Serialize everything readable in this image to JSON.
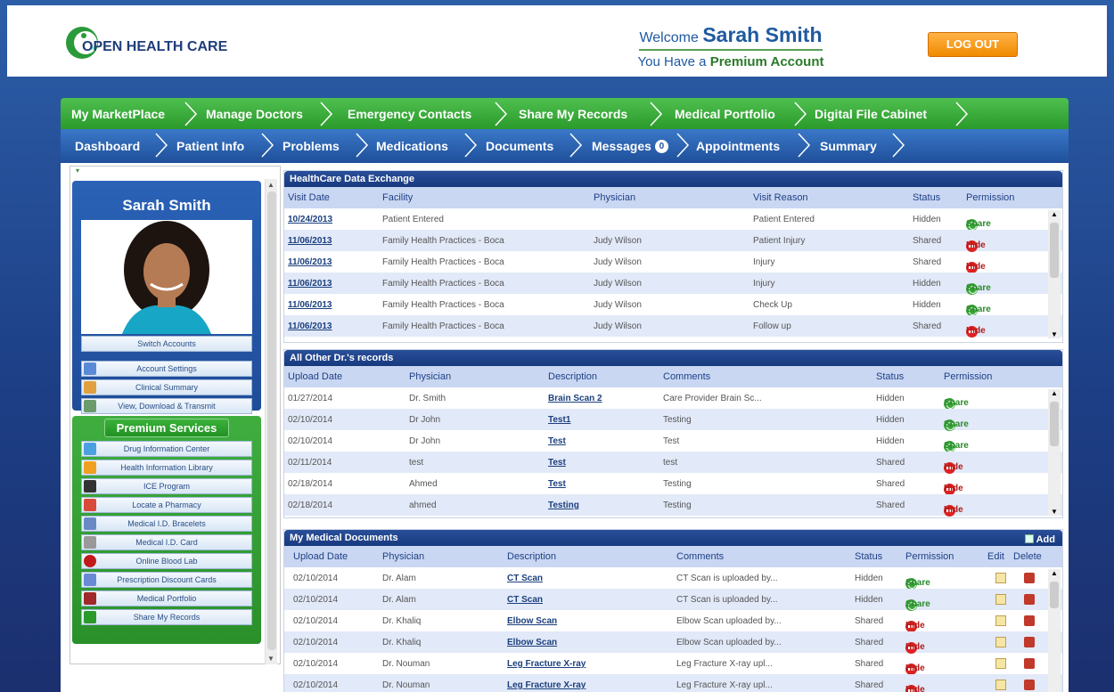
{
  "header": {
    "logo_text": "OPEN HEALTH CARE",
    "welcome_prefix": "Welcome",
    "user_name": "Sarah Smith",
    "account_prefix": "You Have a",
    "account_type": "Premium Account",
    "logout_label": "LOG OUT"
  },
  "nav_top": [
    "My MarketPlace",
    "Manage Doctors",
    "Emergency Contacts",
    "Share My Records",
    "Medical Portfolio",
    "Digital File Cabinet"
  ],
  "nav_bottom": [
    "Dashboard",
    "Patient Info",
    "Problems",
    "Medications",
    "Documents",
    "Messages",
    "Appointments",
    "Summary"
  ],
  "messages_badge": "0",
  "sidebar": {
    "name": "Sarah Smith",
    "switch_accounts": "Switch Accounts",
    "account_links": [
      "Account Settings",
      "Clinical Summary",
      "View, Download & Transmit"
    ],
    "premium_title": "Premium Services",
    "premium_links": [
      "Drug Information Center",
      "Health Information Library",
      "ICE Program",
      "Locate a Pharmacy",
      "Medical I.D. Bracelets",
      "Medical I.D. Card",
      "Online Blood Lab",
      "Prescription Discount Cards",
      "Medical Portfolio",
      "Share My Records"
    ]
  },
  "hde": {
    "title": "HealthCare Data Exchange",
    "headers": [
      "Visit Date",
      "Facility",
      "Physician",
      "Visit Reason",
      "Status",
      "Permission"
    ],
    "rows": [
      {
        "date": "10/24/2013",
        "facility": "Patient Entered",
        "physician": "",
        "reason": "Patient Entered",
        "status": "Hidden",
        "perm": "Share"
      },
      {
        "date": "11/06/2013",
        "facility": "Family Health Practices - Boca",
        "physician": "Judy Wilson",
        "reason": "Patient Injury",
        "status": "Shared",
        "perm": "Hide"
      },
      {
        "date": "11/06/2013",
        "facility": "Family Health Practices - Boca",
        "physician": "Judy Wilson",
        "reason": "Injury",
        "status": "Shared",
        "perm": "Hide"
      },
      {
        "date": "11/06/2013",
        "facility": "Family Health Practices - Boca",
        "physician": "Judy Wilson",
        "reason": "Injury",
        "status": "Hidden",
        "perm": "Share"
      },
      {
        "date": "11/06/2013",
        "facility": "Family Health Practices - Boca",
        "physician": "Judy Wilson",
        "reason": "Check Up",
        "status": "Hidden",
        "perm": "Share"
      },
      {
        "date": "11/06/2013",
        "facility": "Family Health Practices - Boca",
        "physician": "Judy Wilson",
        "reason": "Follow up",
        "status": "Shared",
        "perm": "Hide"
      }
    ]
  },
  "other": {
    "title": "All Other Dr.'s records",
    "headers": [
      "Upload Date",
      "Physician",
      "Description",
      "Comments",
      "Status",
      "Permission"
    ],
    "rows": [
      {
        "date": "01/27/2014",
        "physician": "Dr. Smith",
        "desc": "Brain Scan 2",
        "comment": "Care Provider Brain Sc...",
        "status": "Hidden",
        "perm": "Share"
      },
      {
        "date": "02/10/2014",
        "physician": "Dr John",
        "desc": "Test1",
        "comment": "Testing",
        "status": "Hidden",
        "perm": "Share"
      },
      {
        "date": "02/10/2014",
        "physician": "Dr John",
        "desc": "Test",
        "comment": "Test",
        "status": "Hidden",
        "perm": "Share"
      },
      {
        "date": "02/11/2014",
        "physician": "test",
        "desc": "Test",
        "comment": "test",
        "status": "Shared",
        "perm": "Hide"
      },
      {
        "date": "02/18/2014",
        "physician": "Ahmed",
        "desc": "Test",
        "comment": "Testing",
        "status": "Shared",
        "perm": "Hide"
      },
      {
        "date": "02/18/2014",
        "physician": "ahmed",
        "desc": "Testing",
        "comment": "Testing",
        "status": "Shared",
        "perm": "Hide"
      }
    ]
  },
  "docs": {
    "title": "My Medical Documents",
    "add_label": "Add",
    "headers": [
      "Upload Date",
      "Physician",
      "Description",
      "Comments",
      "Status",
      "Permission",
      "Edit",
      "Delete"
    ],
    "rows": [
      {
        "date": "02/10/2014",
        "physician": "Dr. Alam",
        "desc": "CT Scan",
        "comment": "CT Scan is uploaded by...",
        "status": "Hidden",
        "perm": "Share"
      },
      {
        "date": "02/10/2014",
        "physician": "Dr. Alam",
        "desc": "CT Scan",
        "comment": "CT Scan is uploaded by...",
        "status": "Hidden",
        "perm": "Share"
      },
      {
        "date": "02/10/2014",
        "physician": "Dr. Khaliq",
        "desc": "Elbow Scan",
        "comment": "Elbow Scan uploaded by...",
        "status": "Shared",
        "perm": "Hide"
      },
      {
        "date": "02/10/2014",
        "physician": "Dr. Khaliq",
        "desc": "Elbow Scan",
        "comment": "Elbow Scan uploaded by...",
        "status": "Shared",
        "perm": "Hide"
      },
      {
        "date": "02/10/2014",
        "physician": "Dr. Nouman",
        "desc": "Leg Fracture X-ray",
        "comment": "Leg Fracture X-ray upl...",
        "status": "Shared",
        "perm": "Hide"
      },
      {
        "date": "02/10/2014",
        "physician": "Dr. Nouman",
        "desc": "Leg Fracture X-ray",
        "comment": "Leg Fracture X-ray upl...",
        "status": "Shared",
        "perm": "Hide"
      }
    ]
  }
}
